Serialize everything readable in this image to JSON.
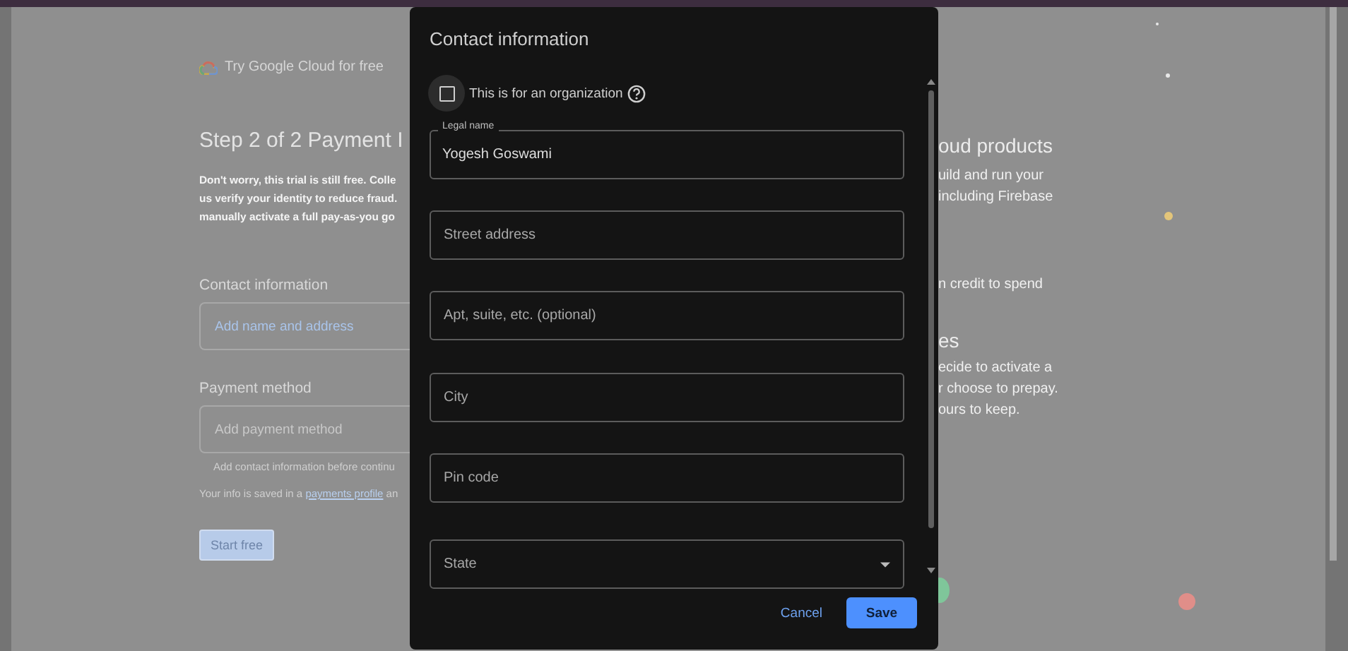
{
  "page": {
    "brand": "Try Google Cloud for free",
    "heading": "Step 2 of 2 Payment I",
    "intro_lines": [
      "Don't worry, this trial is still free. Colle",
      "us verify your identity to reduce fraud.",
      "manually activate a full pay-as-you go"
    ],
    "contact_section": {
      "label": "Contact information",
      "field": {
        "placeholder": "Add name and address",
        "disabled": false
      }
    },
    "payment_section": {
      "label": "Payment method",
      "field": {
        "placeholder": "Add payment method",
        "disabled": true
      },
      "hint": "Add contact information before continu"
    },
    "info_note": {
      "before": "Your info is saved in a ",
      "link": "payments profile",
      "after": " an"
    },
    "start_button": {
      "label": "Start free"
    },
    "right_heading_1": "oud products",
    "right_text_1": [
      "uild and run your",
      "including Firebase"
    ],
    "right_text_2": [
      "n credit to spend"
    ],
    "right_heading_2": "es",
    "right_text_3": [
      "ecide to activate a",
      "r choose to prepay.",
      "ours to keep."
    ]
  },
  "dialog": {
    "title": "Contact information",
    "organization": {
      "label": "This is for an organization",
      "checked": false
    },
    "fields": [
      {
        "kind": "text",
        "label": "Legal name",
        "value": "Yogesh Goswami"
      },
      {
        "kind": "text",
        "placeholder": "Street address"
      },
      {
        "kind": "text",
        "placeholder": "Apt, suite, etc. (optional)"
      },
      {
        "kind": "text",
        "placeholder": "City"
      },
      {
        "kind": "text",
        "placeholder": "Pin code"
      },
      {
        "kind": "select",
        "placeholder": "State"
      }
    ],
    "buttons": [
      {
        "kind": "text",
        "label": "Cancel"
      },
      {
        "kind": "primary",
        "label": "Save"
      }
    ]
  }
}
